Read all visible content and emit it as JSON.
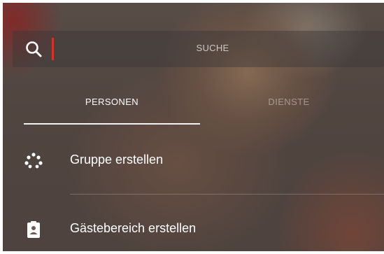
{
  "search": {
    "placeholder_label": "SUCHE",
    "icon": "search-icon",
    "accent_color": "#d2332c"
  },
  "tabs": [
    {
      "label": "PERSONEN",
      "active": true
    },
    {
      "label": "DIENSTE",
      "active": false
    }
  ],
  "menu": {
    "items": [
      {
        "label": "Gruppe erstellen",
        "icon": "group-icon"
      },
      {
        "label": "Gästebereich erstellen",
        "icon": "guest-badge-icon"
      }
    ]
  },
  "colors": {
    "text_primary": "#ffffff",
    "tab_inactive": "rgba(230,220,215,0.5)"
  }
}
